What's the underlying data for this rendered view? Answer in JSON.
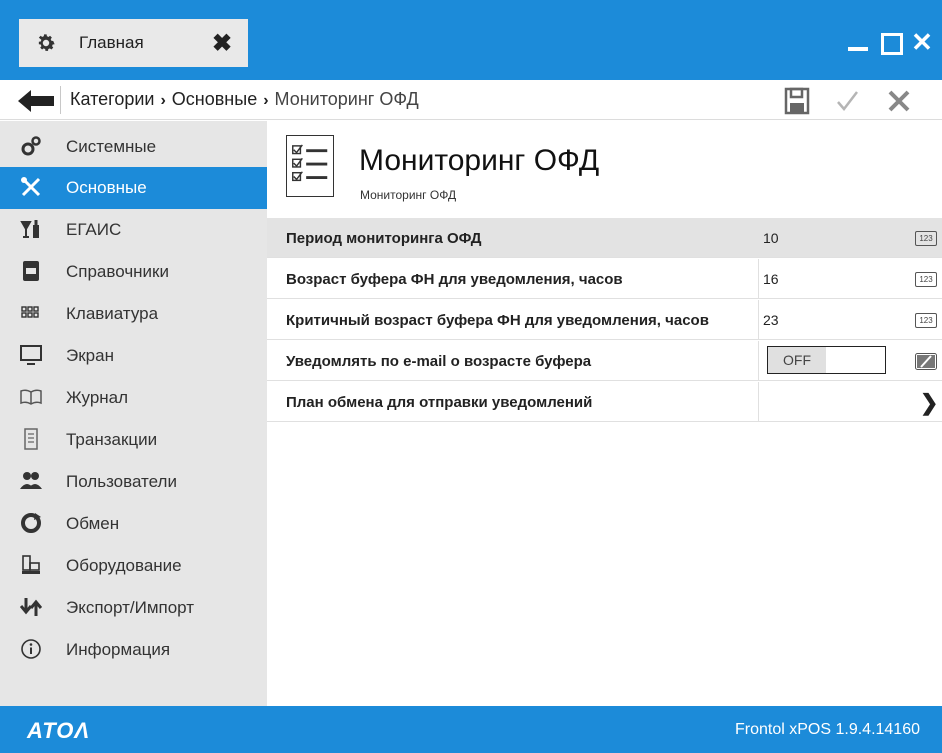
{
  "window": {
    "tab_label": "Главная",
    "tab_icon": "gear-icon",
    "accent_color": "#1c8bd9"
  },
  "navbar": {
    "breadcrumb": [
      {
        "label": "Категории"
      },
      {
        "label": "Основные"
      },
      {
        "label": "Мониторинг ОФД"
      }
    ],
    "actions": [
      "save-icon",
      "check-icon",
      "close-icon"
    ]
  },
  "sidebar": {
    "items": [
      {
        "label": "Системные",
        "icon": "system-gears-icon",
        "active": false
      },
      {
        "label": "Основные",
        "icon": "tools-icon",
        "active": true
      },
      {
        "label": "ЕГАИС",
        "icon": "alcohol-icon",
        "active": false
      },
      {
        "label": "Справочники",
        "icon": "reference-book-icon",
        "active": false
      },
      {
        "label": "Клавиатура",
        "icon": "keyboard-icon",
        "active": false
      },
      {
        "label": "Экран",
        "icon": "monitor-icon",
        "active": false
      },
      {
        "label": "Журнал",
        "icon": "journal-icon",
        "active": false
      },
      {
        "label": "Транзакции",
        "icon": "receipt-icon",
        "active": false
      },
      {
        "label": "Пользователи",
        "icon": "users-icon",
        "active": false
      },
      {
        "label": "Обмен",
        "icon": "exchange-icon",
        "active": false
      },
      {
        "label": "Оборудование",
        "icon": "equipment-icon",
        "active": false
      },
      {
        "label": "Экспорт/Импорт",
        "icon": "export-import-icon",
        "active": false
      },
      {
        "label": "Информация",
        "icon": "info-icon",
        "active": false
      }
    ]
  },
  "main": {
    "title": "Мониторинг ОФД",
    "subtitle": "Мониторинг ОФД",
    "settings": [
      {
        "label": "Период мониторинга ОФД",
        "value": "10",
        "type": "number",
        "badge": "123",
        "selected": true
      },
      {
        "label": "Возраст буфера ФН для уведомления, часов",
        "value": "16",
        "type": "number",
        "badge": "123",
        "selected": false
      },
      {
        "label": "Критичный возраст буфера ФН для уведомления, часов",
        "value": "23",
        "type": "number",
        "badge": "123",
        "selected": false
      },
      {
        "label": "Уведомлять по e-mail о возрасте буфера",
        "value": "OFF",
        "type": "toggle",
        "selected": false
      },
      {
        "label": "План обмена для отправки уведомлений",
        "value": "",
        "type": "link",
        "selected": false
      }
    ]
  },
  "footer": {
    "logo": "ATOΛ",
    "version": "Frontol xPOS 1.9.4.14160"
  }
}
